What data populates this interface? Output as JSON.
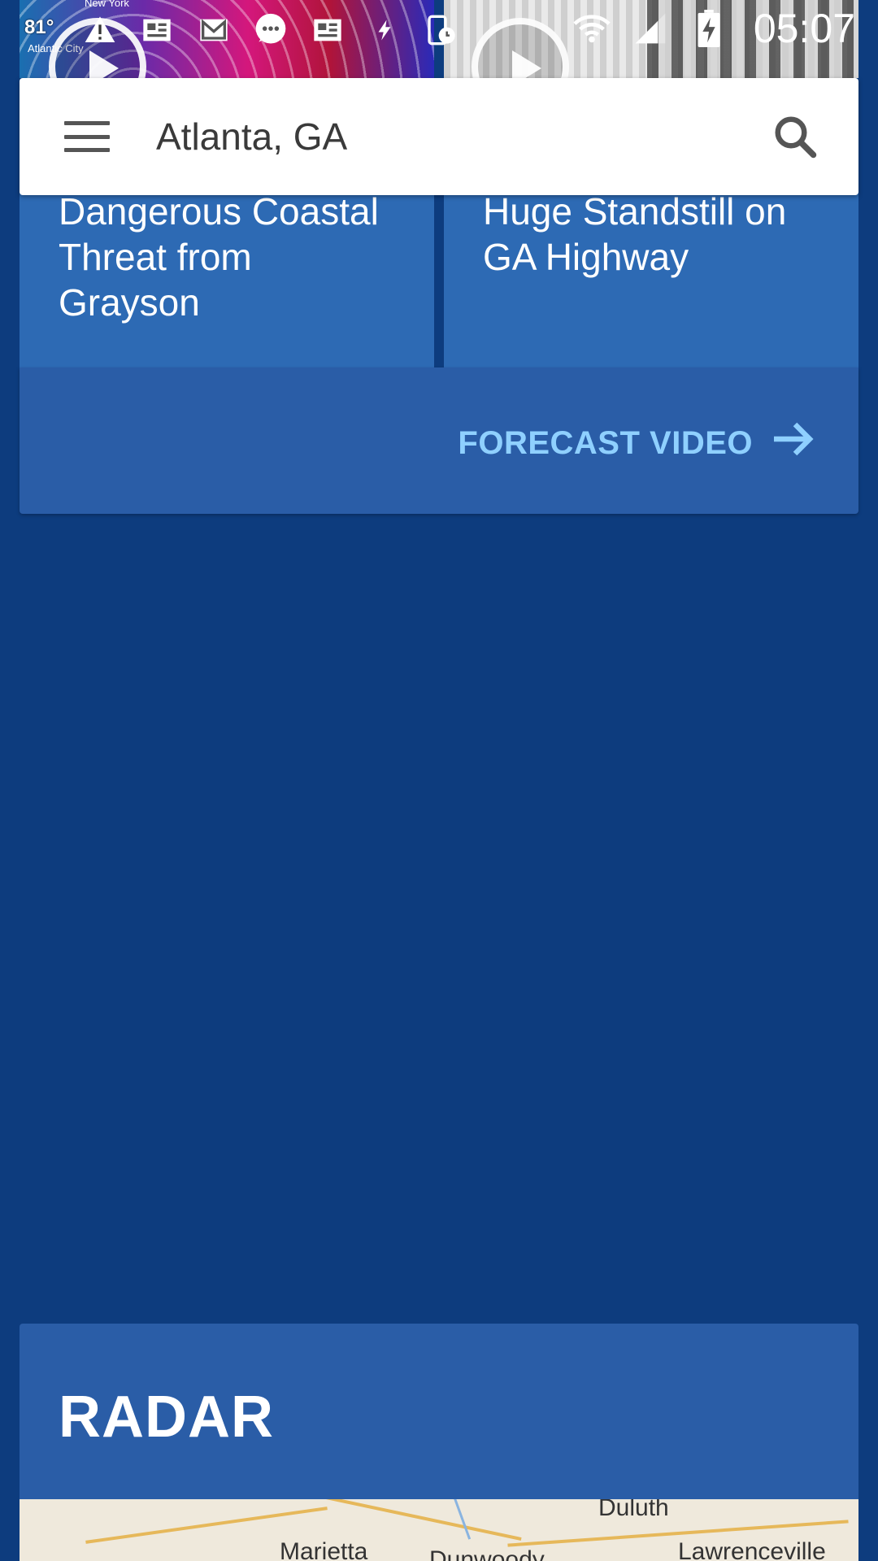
{
  "status_bar": {
    "time": "05:07",
    "icons": [
      "alert-icon",
      "news-icon",
      "gmail-icon",
      "chat-icon",
      "news-icon",
      "flash-icon",
      "device-clock-icon",
      "wifi-icon",
      "signal-icon",
      "battery-charging-icon"
    ]
  },
  "thumbnails": {
    "left": {
      "temp": "81°",
      "city_top": "New York",
      "city_bottom": "Atlantic City"
    },
    "right": {}
  },
  "search": {
    "location": "Atlanta, GA",
    "menu_icon": "hamburger-menu-icon",
    "search_icon": "search-icon"
  },
  "news": [
    {
      "title": "Dangerous Coastal Threat from Grayson"
    },
    {
      "title": "Huge Standstill on GA Highway"
    }
  ],
  "forecast_video": {
    "label": "FORECAST VIDEO",
    "icon": "arrow-right-icon",
    "accent": "#8fd0ff"
  },
  "radar": {
    "title": "RADAR",
    "map_labels": [
      "Duluth",
      "Marietta",
      "Dunwoody",
      "Lawrenceville"
    ]
  },
  "colors": {
    "background": "#0d3c7e",
    "card": "#2d6ab4",
    "card_footer": "#2a5da7"
  }
}
